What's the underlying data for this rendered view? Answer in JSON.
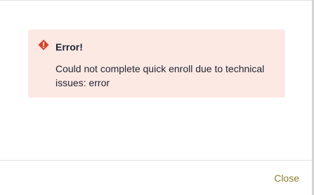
{
  "alert": {
    "title": "Error!",
    "message": "Could not complete quick enroll due to technical issues: error",
    "icon": "error-diamond-icon",
    "icon_color": "#e0401f",
    "background_color": "#fde9e4"
  },
  "footer": {
    "close_label": "Close",
    "close_color": "#8c7a2e"
  }
}
